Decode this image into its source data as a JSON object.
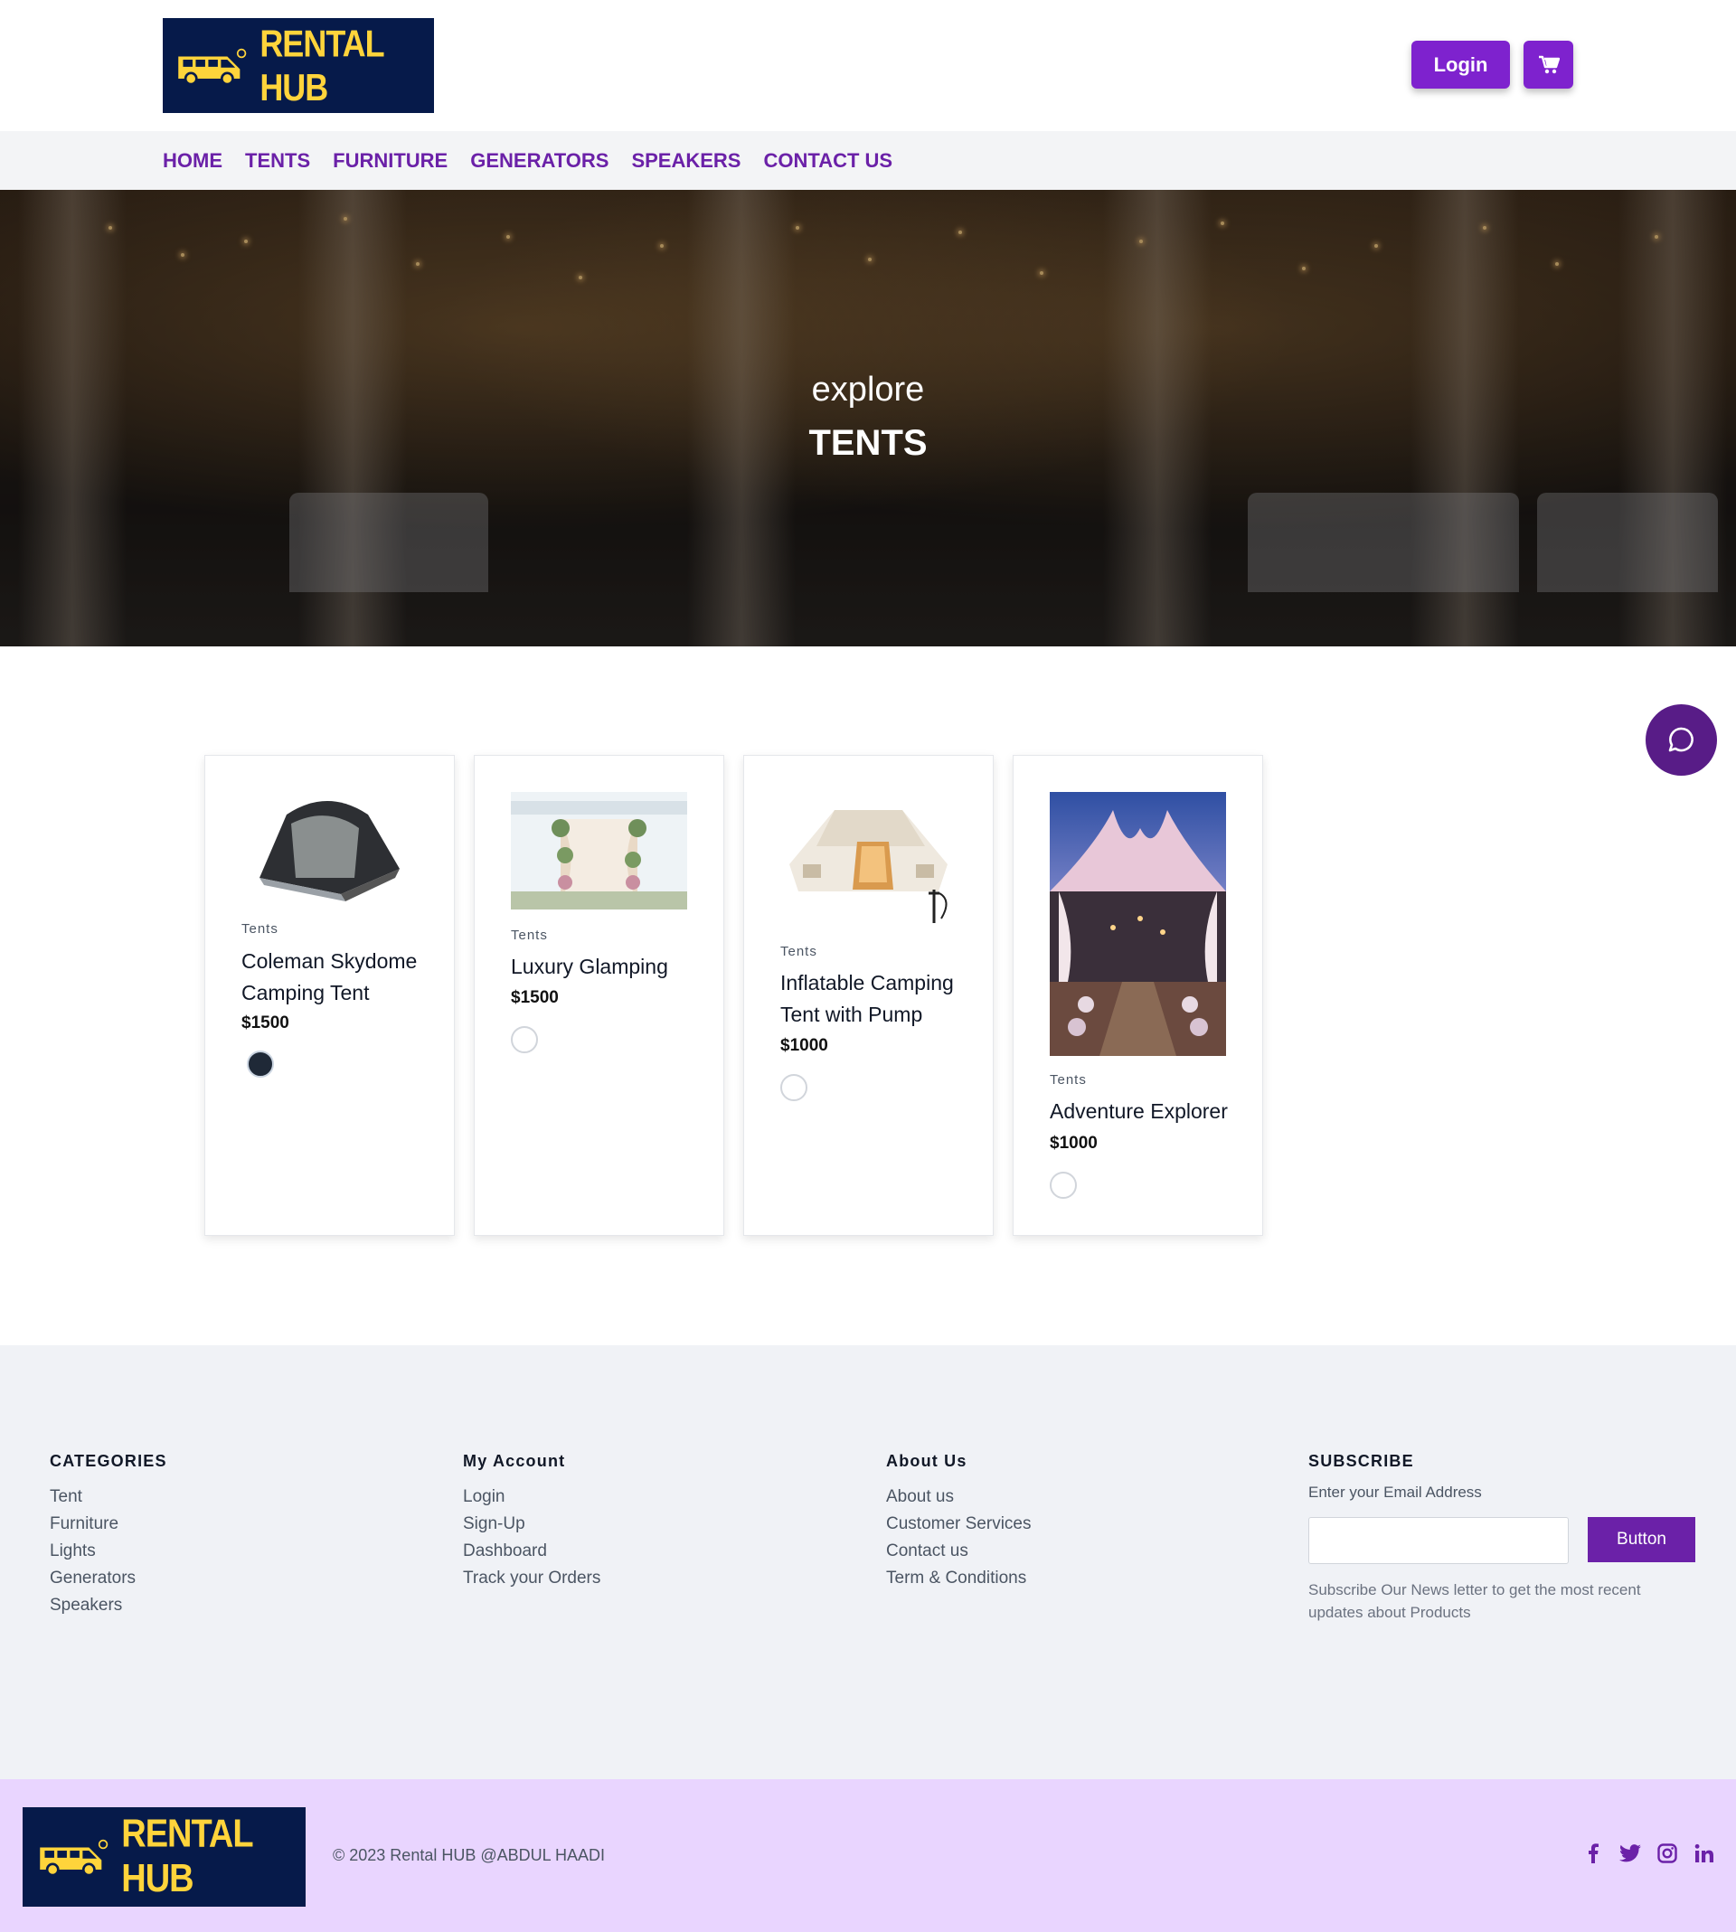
{
  "brand": {
    "name": "RENTAL HUB"
  },
  "header": {
    "login_label": "Login"
  },
  "nav": [
    "HOME",
    "TENTS",
    "FURNITURE",
    "GENERATORS",
    "SPEAKERS",
    "CONTACT US"
  ],
  "hero": {
    "subtitle": "explore",
    "title": "TENTS"
  },
  "products": [
    {
      "category": "Tents",
      "title": "Coleman Skydome Camping Tent",
      "price": "$1500",
      "swatch": "#1f2937"
    },
    {
      "category": "Tents",
      "title": "Luxury Glamping",
      "price": "$1500",
      "swatch": "#ffffff"
    },
    {
      "category": "Tents",
      "title": "Inflatable Camping Tent with Pump",
      "price": "$1000",
      "swatch": "#ffffff"
    },
    {
      "category": "Tents",
      "title": "Adventure Explorer",
      "price": "$1000",
      "swatch": "#ffffff"
    }
  ],
  "footer": {
    "categories": {
      "title": "CATEGORIES",
      "items": [
        "Tent",
        "Furniture",
        "Lights",
        "Generators",
        "Speakers"
      ]
    },
    "account": {
      "title": "My Account",
      "items": [
        "Login",
        "Sign-Up",
        "Dashboard",
        "Track your Orders"
      ]
    },
    "about": {
      "title": "About Us",
      "items": [
        "About us",
        "Customer Services",
        "Contact us",
        "Term & Conditions"
      ]
    },
    "subscribe": {
      "title": "SUBSCRIBE",
      "label": "Enter your Email Address",
      "button": "Button",
      "note": "Subscribe Our News letter to get the most recent updates about Products"
    },
    "copyright": "© 2023 Rental HUB @ABDUL HAADI"
  },
  "icons": {
    "cart": "cart-icon",
    "chat": "chat-icon",
    "social": [
      "facebook-icon",
      "twitter-icon",
      "instagram-icon",
      "linkedin-icon"
    ]
  },
  "colors": {
    "accent": "#7e22ce",
    "nav_text": "#6b21a8",
    "brand_bg": "#061a4a",
    "brand_text": "#ffd43b",
    "footer_bar": "#e9d5ff"
  }
}
